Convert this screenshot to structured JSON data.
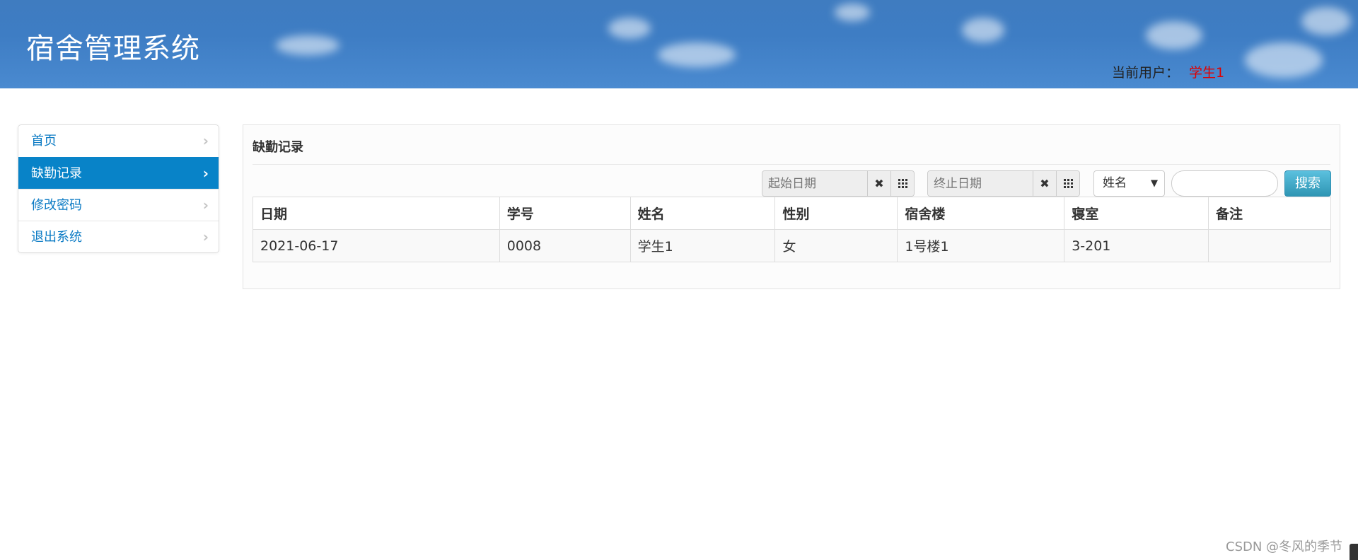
{
  "header": {
    "title": "宿舍管理系统",
    "current_user_label": "当前用户：",
    "current_user_name": "学生1",
    "colors": {
      "banner": "#3e7dc4",
      "user_name": "#e00000"
    }
  },
  "sidebar": {
    "items": [
      {
        "label": "首页",
        "active": false
      },
      {
        "label": "缺勤记录",
        "active": true
      },
      {
        "label": "修改密码",
        "active": false
      },
      {
        "label": "退出系统",
        "active": false
      }
    ],
    "active_color": "#0883c8"
  },
  "main": {
    "title": "缺勤记录",
    "filters": {
      "start_date_placeholder": "起始日期",
      "end_date_placeholder": "终止日期",
      "field_select_value": "姓名",
      "search_value": "",
      "search_label": "搜索"
    },
    "table": {
      "columns": [
        "日期",
        "学号",
        "姓名",
        "性别",
        "宿舍楼",
        "寝室",
        "备注"
      ],
      "rows": [
        [
          "2021-06-17",
          "0008",
          "学生1",
          "女",
          "1号楼1",
          "3-201",
          ""
        ]
      ]
    }
  },
  "watermark": "CSDN @冬风的季节"
}
